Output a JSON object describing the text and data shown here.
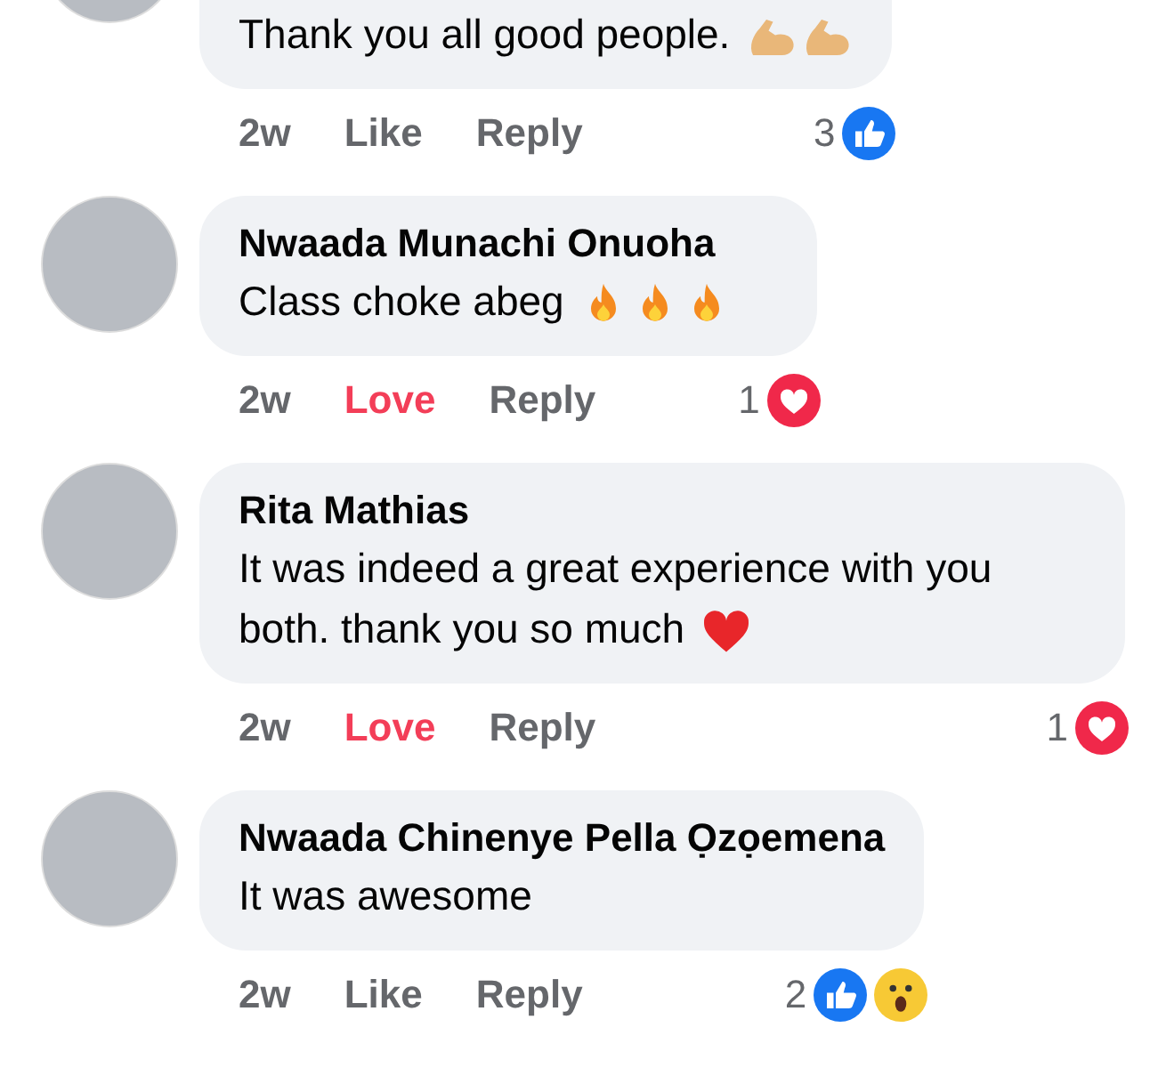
{
  "comments": [
    {
      "text": "Thank you all good people.",
      "emojis": [
        {
          "kind": "biceps"
        },
        {
          "kind": "biceps"
        }
      ],
      "time": "2w",
      "reaction": {
        "label": "Like",
        "reacted": false
      },
      "reply": "Reply",
      "badge": {
        "count": "3",
        "icons": [
          {
            "kind": "like"
          }
        ]
      }
    },
    {
      "name": "Nwaada Munachi Onuoha",
      "text": "Class choke abeg",
      "emojis": [
        {
          "kind": "fire"
        },
        {
          "kind": "fire"
        },
        {
          "kind": "fire"
        }
      ],
      "time": "2w",
      "reaction": {
        "label": "Love",
        "reacted": true
      },
      "reply": "Reply",
      "badge": {
        "count": "1",
        "icons": [
          {
            "kind": "love"
          }
        ]
      }
    },
    {
      "name": "Rita Mathias",
      "text": "It was indeed a great experience with you both. thank you so much",
      "emojis": [
        {
          "kind": "heart"
        }
      ],
      "time": "2w",
      "reaction": {
        "label": "Love",
        "reacted": true
      },
      "reply": "Reply",
      "badge": {
        "count": "1",
        "icons": [
          {
            "kind": "love"
          }
        ]
      }
    },
    {
      "name": "Nwaada Chinenye Pella Ọzọemena",
      "text": "It was awesome",
      "time": "2w",
      "reaction": {
        "label": "Like",
        "reacted": false
      },
      "reply": "Reply",
      "badge": {
        "count": "2",
        "icons": [
          {
            "kind": "like"
          },
          {
            "kind": "wow"
          }
        ]
      }
    }
  ]
}
